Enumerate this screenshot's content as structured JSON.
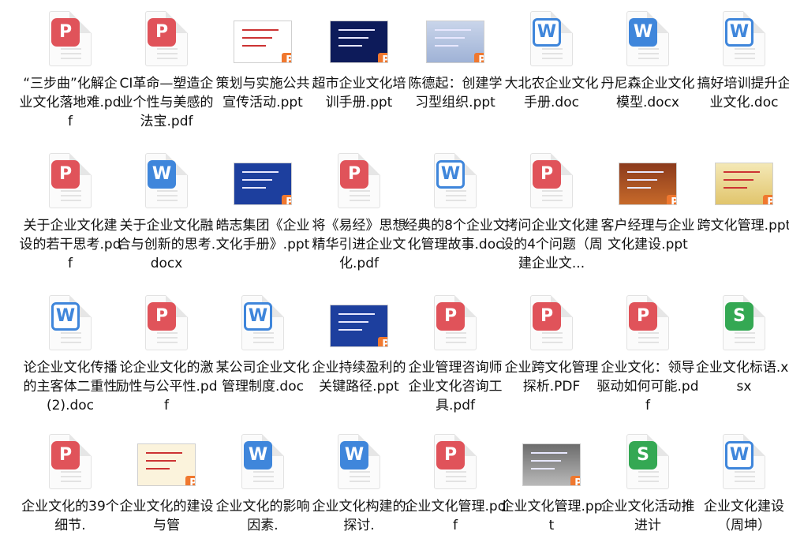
{
  "files": [
    {
      "name": "“三步曲”化解企业文化落地难.pdf",
      "type": "pdf"
    },
    {
      "name": "CI革命—塑造企业个性与美感的法宝.pdf",
      "type": "pdf"
    },
    {
      "name": "策划与实施公共宣传活动.ppt",
      "type": "ppt",
      "thumb": "white"
    },
    {
      "name": "超市企业文化培训手册.ppt",
      "type": "ppt",
      "thumb": "navy"
    },
    {
      "name": "陈德起：创建学习型组织.ppt",
      "type": "ppt",
      "thumb": "gray"
    },
    {
      "name": "大北农企业文化手册.doc",
      "type": "doc"
    },
    {
      "name": "丹尼森企业文化模型.docx",
      "type": "docx"
    },
    {
      "name": "搞好培训提升企业文化.doc",
      "type": "doc"
    },
    {
      "name": "关于企业文化建设的若干思考.pdf",
      "type": "pdf"
    },
    {
      "name": "关于企业文化融合与创新的思考.docx",
      "type": "docx"
    },
    {
      "name": "皓志集团《企业文化手册》.ppt",
      "type": "ppt",
      "thumb": "blue"
    },
    {
      "name": "将《易经》思想精华引进企业文化.pdf",
      "type": "pdf"
    },
    {
      "name": "经典的8个企业文化管理故事.doc",
      "type": "doc"
    },
    {
      "name": "拷问企业文化建设的4个问题（周建企业文...",
      "type": "pdf"
    },
    {
      "name": "客户经理与企业文化建设.ppt",
      "type": "ppt",
      "thumb": "brown"
    },
    {
      "name": "跨文化管理.ppt",
      "type": "ppt",
      "thumb": "gold"
    },
    {
      "name": "论企业文化传播的主客体二重性(2).doc",
      "type": "doc"
    },
    {
      "name": "论企业文化的激励性与公平性.pdf",
      "type": "pdf"
    },
    {
      "name": "某公司企业文化管理制度.doc",
      "type": "doc"
    },
    {
      "name": "企业持续盈利的关键路径.ppt",
      "type": "ppt",
      "thumb": "blue"
    },
    {
      "name": "企业管理咨询师企业文化咨询工具.pdf",
      "type": "pdf"
    },
    {
      "name": "企业跨文化管理探析.PDF",
      "type": "pdf"
    },
    {
      "name": "企业文化：领导驱动如何可能.pdf",
      "type": "pdf"
    },
    {
      "name": "企业文化标语.xlsx",
      "type": "xlsx"
    },
    {
      "name": "企业文化的39个细节.",
      "type": "pdf"
    },
    {
      "name": "企业文化的建设与管",
      "type": "ppt",
      "thumb": "pale"
    },
    {
      "name": "企业文化的影响因素.",
      "type": "docx"
    },
    {
      "name": "企业文化构建的探讨.",
      "type": "docx"
    },
    {
      "name": "企业文化管理.pdf",
      "type": "pdf"
    },
    {
      "name": "企业文化管理.ppt",
      "type": "ppt",
      "thumb": "photo"
    },
    {
      "name": "企业文化活动推进计",
      "type": "xlsx"
    },
    {
      "name": "企业文化建设（周坤）",
      "type": "doc"
    }
  ],
  "colors": {
    "pdf": "#e0535a",
    "doc": "#3f86db",
    "xlsx": "#34a853",
    "ppt": "#f0782f"
  },
  "icons": {
    "pdf": "pdf-file-icon",
    "doc": "word-file-icon",
    "docx": "word-file-icon",
    "xlsx": "excel-file-icon",
    "ppt": "ppt-thumbnail-icon"
  }
}
